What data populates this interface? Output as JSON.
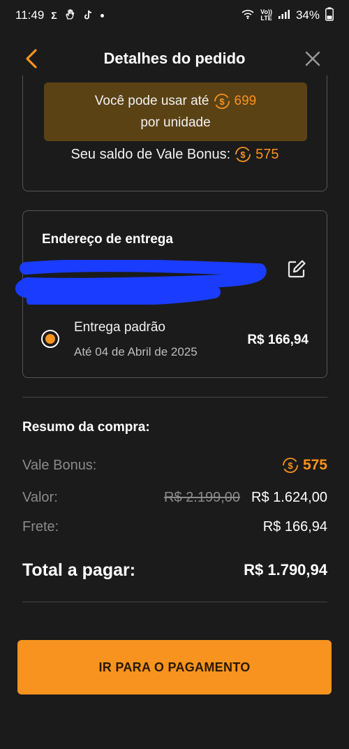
{
  "status_bar": {
    "time": "11:49",
    "sigma": "Σ",
    "battery": "34%",
    "volte_top": "Vo))",
    "volte_bottom": "LTE",
    "icons": [
      "hand-icon",
      "tiktok-icon",
      "wifi-icon",
      "signal-icon",
      "battery-icon"
    ]
  },
  "header": {
    "title": "Detalhes do pedido"
  },
  "bonus": {
    "usage_prefix": "Você pode usar até",
    "usage_amount": "699",
    "usage_suffix": "por unidade",
    "balance_label": "Seu saldo de Vale Bonus:",
    "balance_amount": "575"
  },
  "address": {
    "title": "Endereço de entrega",
    "shipping_name": "Entrega padrão",
    "shipping_date": "Até 04 de Abril de 2025",
    "shipping_price": "R$ 166,94",
    "shipping_selected": true
  },
  "summary": {
    "title": "Resumo da compra:",
    "vale_bonus_label": "Vale Bonus:",
    "vale_bonus_value": "575",
    "valor_label": "Valor:",
    "valor_original": "R$ 2.199,00",
    "valor_final": "R$ 1.624,00",
    "frete_label": "Frete:",
    "frete_value": "R$ 166,94",
    "total_label": "Total a pagar:",
    "total_value": "R$ 1.790,94"
  },
  "action": {
    "pay_label": "IR PARA O PAGAMENTO"
  },
  "colors": {
    "accent": "#f7931e",
    "background": "#1b1b1b",
    "highlight_bg": "#5a4215",
    "redaction": "#1a3cff"
  }
}
